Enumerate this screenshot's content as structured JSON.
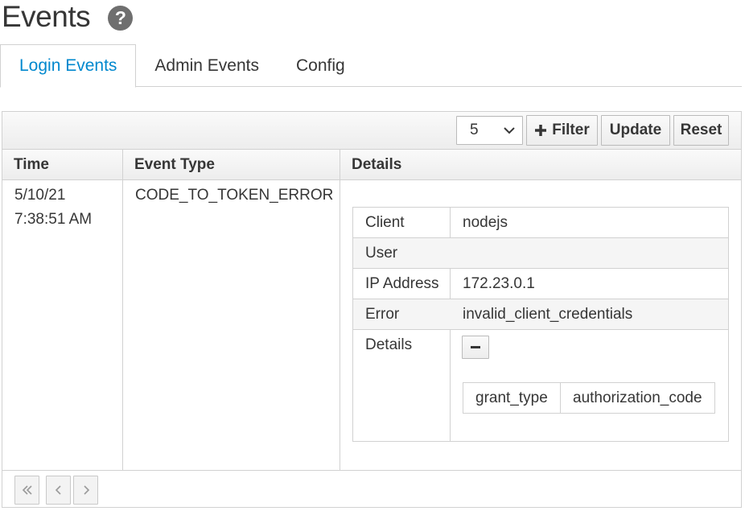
{
  "page": {
    "title": "Events"
  },
  "tabs": [
    {
      "label": "Login Events",
      "active": true
    },
    {
      "label": "Admin Events",
      "active": false
    },
    {
      "label": "Config",
      "active": false
    }
  ],
  "toolbar": {
    "page_size": "5",
    "filter_label": "Filter",
    "update_label": "Update",
    "reset_label": "Reset"
  },
  "table": {
    "columns": [
      "Time",
      "Event Type",
      "Details"
    ],
    "rows": [
      {
        "date": "5/10/21",
        "time": "7:38:51 AM",
        "event_type": "CODE_TO_TOKEN_ERROR",
        "details": {
          "fields": [
            {
              "label": "Client",
              "value": "nodejs"
            },
            {
              "label": "User",
              "value": ""
            },
            {
              "label": "IP Address",
              "value": "172.23.0.1"
            },
            {
              "label": "Error",
              "value": "invalid_client_credentials"
            },
            {
              "label": "Details",
              "value": ""
            }
          ],
          "extra": [
            {
              "key": "grant_type",
              "value": "authorization_code"
            }
          ]
        }
      }
    ]
  },
  "pagination": {
    "first_icon": "double-chevron-left-icon",
    "prev_icon": "chevron-left-icon",
    "next_icon": "chevron-right-icon"
  },
  "colors": {
    "accent": "#0088ce",
    "text": "#363636",
    "border": "#d1d1d1",
    "alt_row": "#f5f5f5"
  }
}
